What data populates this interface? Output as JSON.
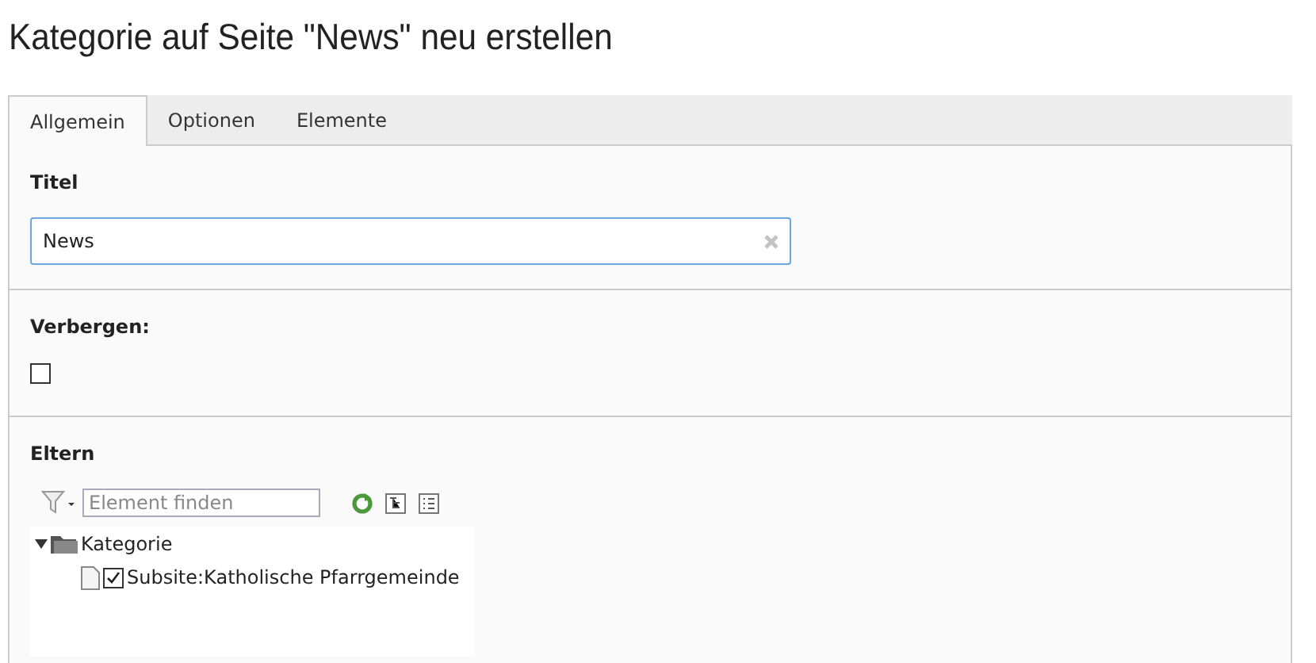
{
  "heading": "Kategorie auf Seite \"News\" neu erstellen",
  "tabs": [
    {
      "label": "Allgemein",
      "selected": true
    },
    {
      "label": "Optionen",
      "selected": false
    },
    {
      "label": "Elemente",
      "selected": false
    }
  ],
  "title_field": {
    "label": "Titel",
    "value": "News"
  },
  "hide_field": {
    "label": "Verbergen:",
    "checked": false
  },
  "parent_field": {
    "label": "Eltern",
    "search": {
      "placeholder": "Element finden"
    },
    "tree": [
      {
        "label": "Kategorie",
        "expanded": true,
        "children": [
          {
            "label": "Subsite:Katholische Pfarrgemeinde",
            "checked": true
          }
        ]
      }
    ]
  }
}
